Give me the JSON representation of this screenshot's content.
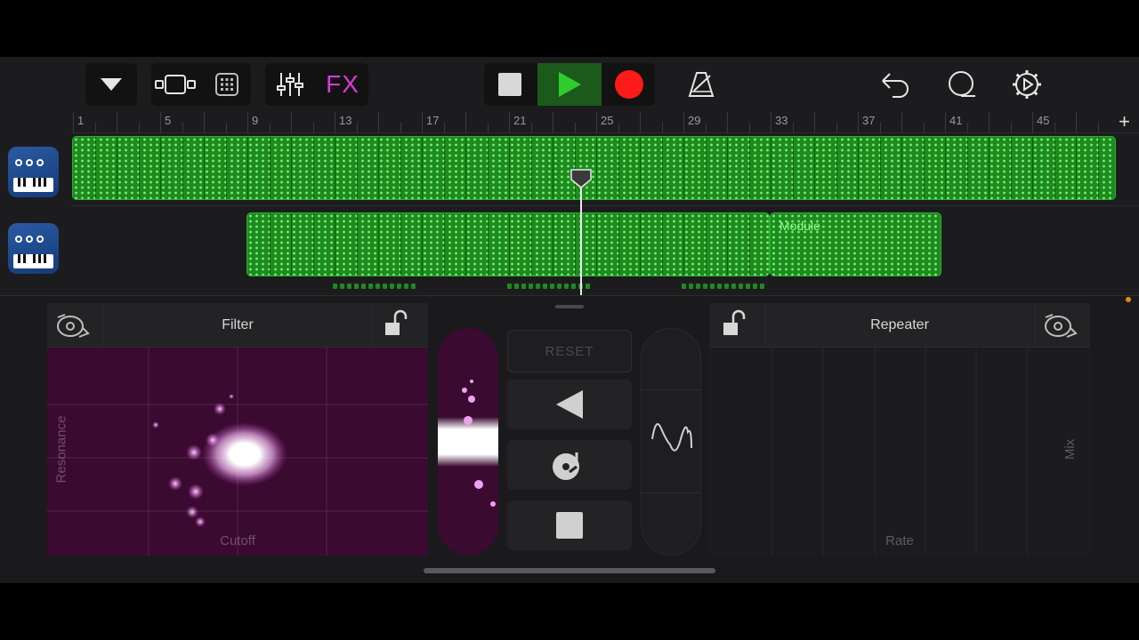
{
  "toolbar": {
    "fx_label": "FX"
  },
  "ruler": {
    "bar_labels": [
      "1",
      "5",
      "9",
      "13",
      "17",
      "21",
      "25",
      "29",
      "33",
      "37",
      "41",
      "45"
    ]
  },
  "tracks": [
    {
      "instrument_icon": "synth-keyboard-icon"
    },
    {
      "instrument_icon": "synth-keyboard-icon",
      "region_label": "Module"
    }
  ],
  "fx_left": {
    "title": "Filter",
    "x_axis": "Cutoff",
    "y_axis": "Resonance",
    "pad_color": "#3a0a30"
  },
  "fx_right": {
    "title": "Repeater",
    "x_axis": "Rate",
    "y_axis": "Mix"
  },
  "center": {
    "reset_label": "RESET"
  },
  "colors": {
    "region_green": "#1f8a1f",
    "fx_magenta": "#d63bd6",
    "record_red": "#ff1a1a",
    "play_green": "#2ecc2e"
  }
}
